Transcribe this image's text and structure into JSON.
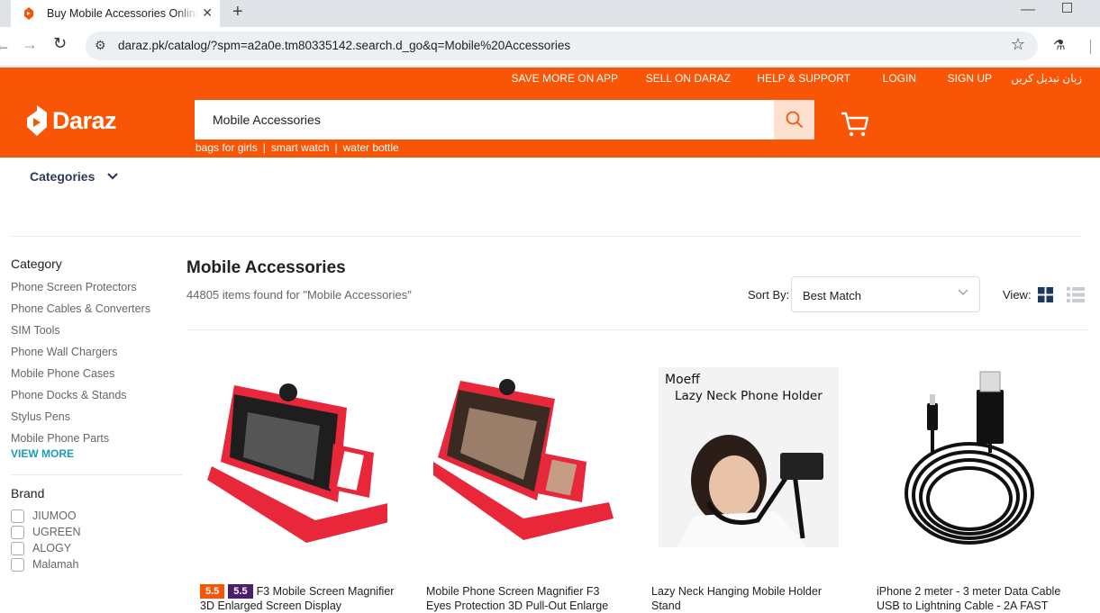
{
  "browser": {
    "tab_title": "Buy Mobile Accessories Online at Best Price",
    "url": "daraz.pk/catalog/?spm=a2a0e.tm80335142.search.d_go&q=Mobile%20Accessories"
  },
  "header": {
    "top_links": [
      "SAVE MORE ON APP",
      "SELL ON DARAZ",
      "HELP & SUPPORT",
      "LOGIN",
      "SIGN UP",
      "زبان تبدیل کریں"
    ],
    "logo_text": "Daraz",
    "search_value": "Mobile Accessories",
    "suggestions": [
      "bags for girls",
      "smart watch",
      "water bottle"
    ],
    "brand_color": "#f85606"
  },
  "nav": {
    "categories_label": "Categories"
  },
  "sidebar": {
    "category_title": "Category",
    "categories": [
      "Phone Screen Protectors",
      "Phone Cables & Converters",
      "SIM Tools",
      "Phone Wall Chargers",
      "Mobile Phone Cases",
      "Phone Docks & Stands",
      "Stylus Pens",
      "Mobile Phone Parts"
    ],
    "view_more": "VIEW MORE",
    "brand_title": "Brand",
    "brands": [
      "JIUMOO",
      "UGREEN",
      "ALOGY",
      "Malamah"
    ]
  },
  "main": {
    "title": "Mobile Accessories",
    "result_count": "44805 items found for \"Mobile Accessories\"",
    "sort_label": "Sort By:",
    "sort_value": "Best Match",
    "view_label": "View:"
  },
  "products": [
    {
      "badges": [
        "5.5",
        "5.5"
      ],
      "title": "F3 Mobile Screen Magnifier 3D Enlarged Screen Display"
    },
    {
      "badges": [],
      "title": "Mobile Phone Screen Magnifier F3 Eyes Protection 3D Pull-Out Enlarge"
    },
    {
      "badges": [],
      "title": "Lazy Neck Hanging Mobile Holder Stand",
      "image_text": [
        "Moeff",
        "Lazy Neck Phone Holder"
      ]
    },
    {
      "badges": [],
      "title": "iPhone 2 meter - 3 meter Data Cable USB to Lightning Cable - 2A FAST"
    }
  ]
}
